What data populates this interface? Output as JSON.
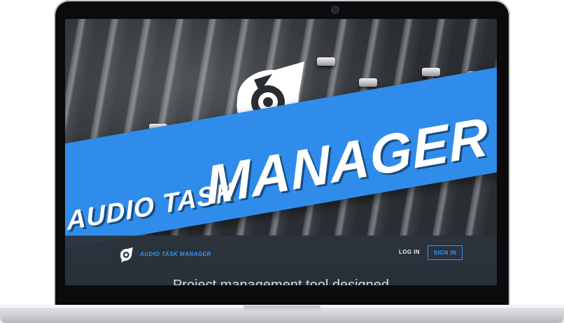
{
  "page": {
    "hero_title_small": "AUDIO TASK",
    "hero_title_big": "MANAGER",
    "hero_text": "Project management tool designed"
  },
  "nav": {
    "brand": "AUDIO TASK MANAGER",
    "login_label": "LOG IN",
    "signin_label": "SIGN IN"
  },
  "colors": {
    "accent": "#2f8ceb",
    "brand_blue": "#3a95ef",
    "nav_bg": "#2c343e"
  },
  "icons": {
    "logo": "audio-task-manager-logo-icon",
    "camera": "camera-icon"
  }
}
